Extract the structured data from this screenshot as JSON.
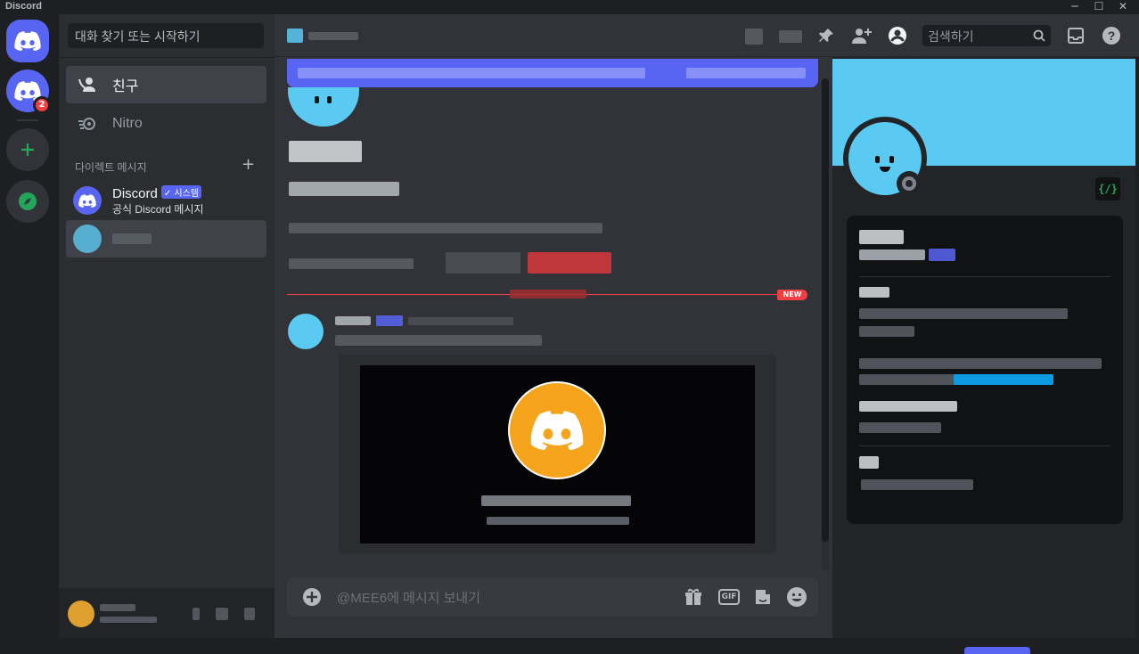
{
  "window": {
    "title": "Discord",
    "controls": [
      "─",
      "☐",
      "✕"
    ]
  },
  "rail": {
    "home_icon": "discord-logo-icon",
    "server_badge": "2",
    "add_server_icon": "plus-icon",
    "explore_icon": "compass-icon"
  },
  "dm_sidebar": {
    "search_placeholder": "대화 찾기 또는 시작하기",
    "nav": [
      {
        "label": "친구",
        "icon": "friends-icon"
      },
      {
        "label": "Nitro",
        "icon": "nitro-icon"
      }
    ],
    "section_header": "다이렉트 메시지",
    "section_add": "+",
    "conversations": [
      {
        "name": "Discord",
        "tag": "✓ 시스템",
        "subtitle": "공식 Discord 메시지"
      }
    ]
  },
  "topbar": {
    "search_placeholder": "검색하기",
    "icons": [
      "pin-icon",
      "add-friend-icon",
      "profile-toggle-icon",
      "search-icon",
      "inbox-icon",
      "help-icon"
    ]
  },
  "chat": {
    "new_marker": "NEW",
    "composer_placeholder": "@MEE6에 메시지 보내기",
    "composer_gif": "GIF"
  },
  "profile_panel": {
    "dev_badge": "{/}"
  },
  "colors": {
    "blurple": "#5865f2",
    "red": "#f23f43",
    "avatar_blue": "#5bcaf2",
    "embed_orange": "#f6a41c",
    "green": "#23a55a"
  }
}
